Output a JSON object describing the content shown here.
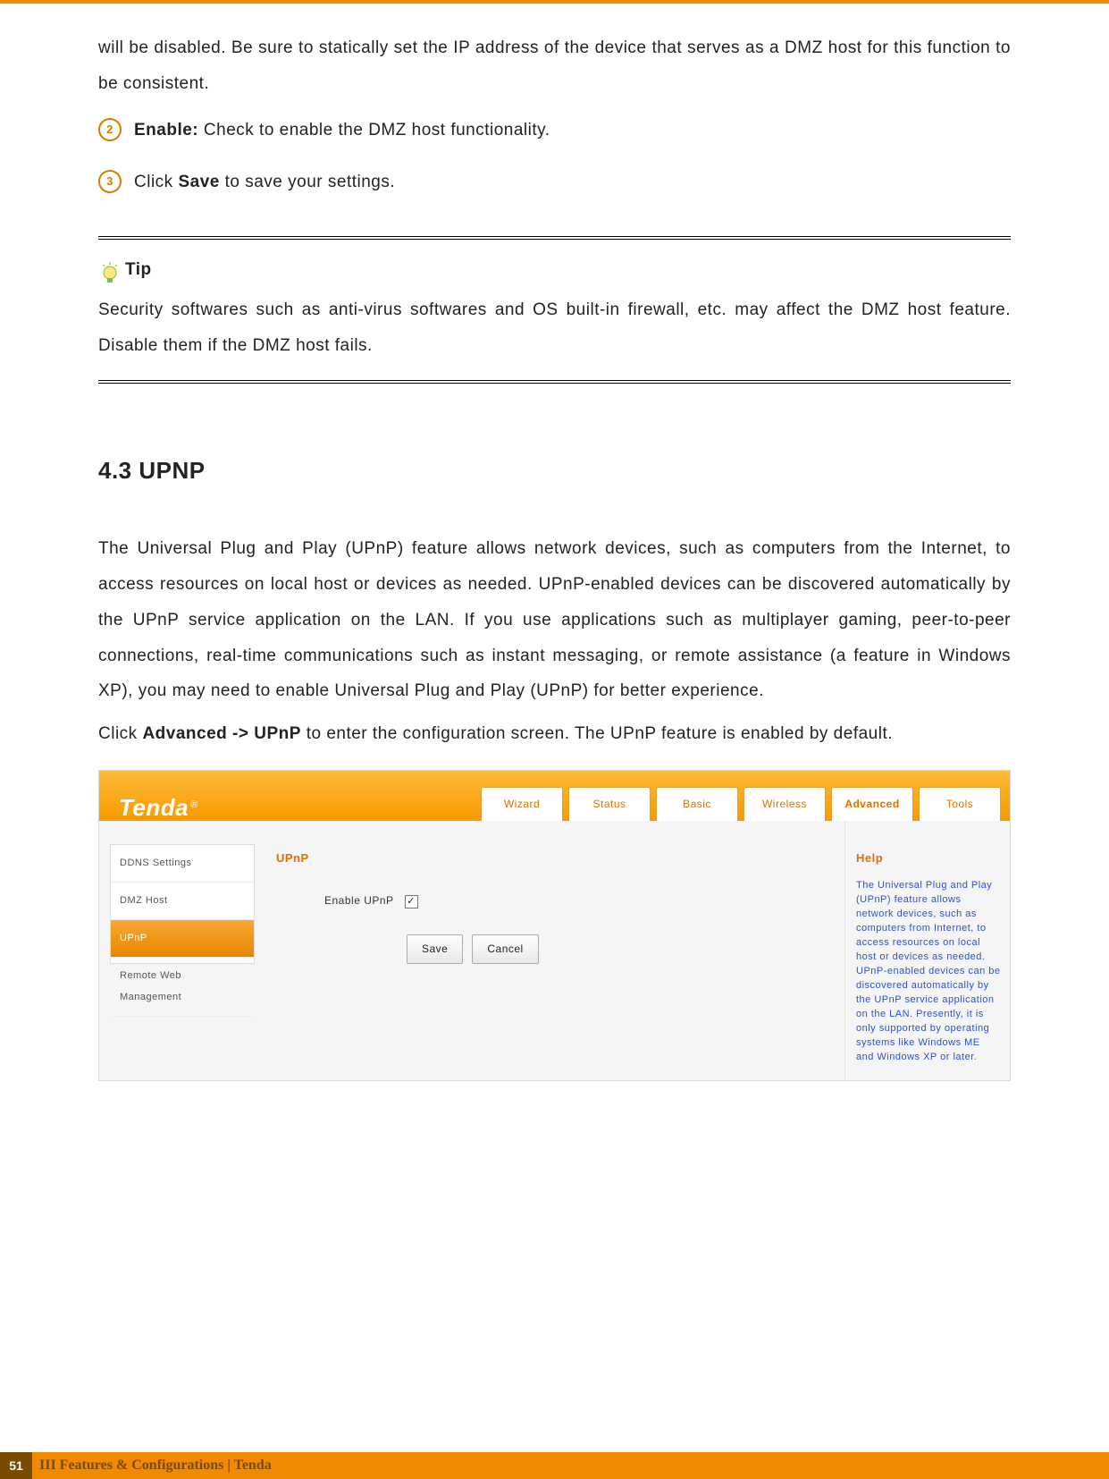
{
  "intro": "will be disabled. Be sure to statically set the IP address of the device that serves as a DMZ host for this function to be consistent.",
  "item2_num": "2",
  "item2_label": "Enable:",
  "item2_text": " Check to enable the DMZ host functionality.",
  "item3_num": "3",
  "item3_pre": "Click ",
  "item3_bold": "Save",
  "item3_post": " to save your settings.",
  "tip_label": "Tip",
  "tip_text": "Security softwares such as anti-virus softwares and OS built-in firewall, etc. may affect the DMZ host feature. Disable them if the DMZ host fails.",
  "section_heading": "4.3 UPNP",
  "upnp_para": "The Universal Plug and Play (UPnP) feature allows network devices, such as computers from the Internet, to access resources on local host or devices as needed. UPnP-enabled devices can be discovered automatically by the UPnP service application on the LAN. If you use applications such as multiplayer gaming, peer-to-peer connections, real-time communications such as instant messaging, or remote assistance (a feature in Windows XP), you may need to enable Universal Plug and Play (UPnP) for better experience.",
  "upnp_click_pre": "Click ",
  "upnp_click_bold": "Advanced -> UPnP",
  "upnp_click_post": " to enter the configuration screen. The UPnP feature is enabled by default.",
  "logo_text": "Tenda",
  "logo_r": "®",
  "tabs": [
    "Wizard",
    "Status",
    "Basic",
    "Wireless",
    "Advanced",
    "Tools"
  ],
  "side_items": [
    "DDNS Settings",
    "DMZ Host",
    "UPnP",
    "Remote Web Management"
  ],
  "main_title": "UPnP",
  "enable_label": "Enable UPnP",
  "chk_mark": "✓",
  "btn_save": "Save",
  "btn_cancel": "Cancel",
  "help_title": "Help",
  "help_text": "The Universal Plug and Play (UPnP) feature allows network devices, such as computers from Internet, to access resources on local host or devices as needed. UPnP-enabled devices can be discovered automatically by the UPnP service application on the LAN. Presently, it is only supported by operating systems like Windows ME and Windows XP or later.",
  "page_number": "51",
  "footer_text": "III Features & Configurations | Tenda"
}
